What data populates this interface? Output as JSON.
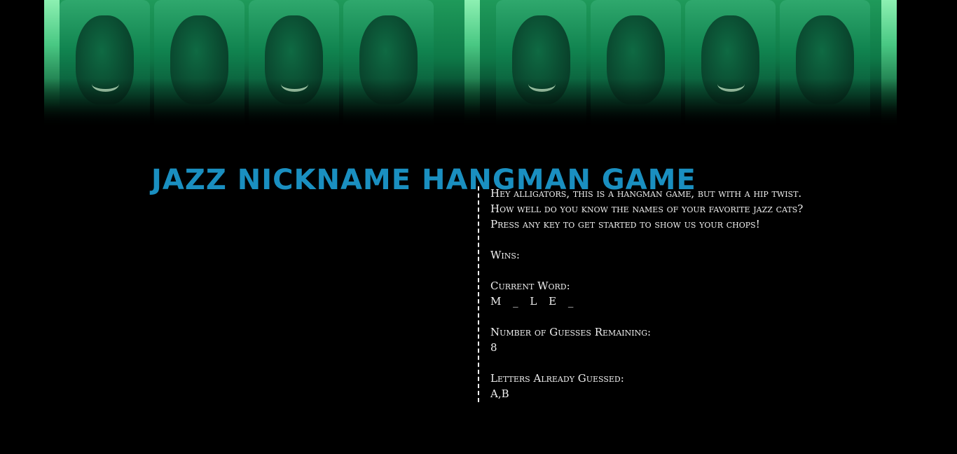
{
  "banner": {
    "icon": "jazz-musician-portraits-image"
  },
  "title": "Jazz Nickname Hangman Game",
  "intro": {
    "line1": "Hey alligators, this is a hangman game, but with a hip twist.",
    "line2": "How well do you know the names of your favorite jazz cats?",
    "line3": "Press any key to get started to show us your chops!"
  },
  "stats": {
    "wins_label": "Wins:",
    "wins_value": "",
    "current_word_label": "Current Word:",
    "current_word": "M _ L E _",
    "guesses_remaining_label": "Number of Guesses Remaining:",
    "guesses_remaining": "8",
    "letters_guessed_label": "Letters Already Guessed:",
    "letters_guessed": "A,B"
  },
  "colors": {
    "title": "#1a8fc0",
    "background": "#000000",
    "text": "#f0f0f0",
    "banner_green": "#10834f"
  }
}
